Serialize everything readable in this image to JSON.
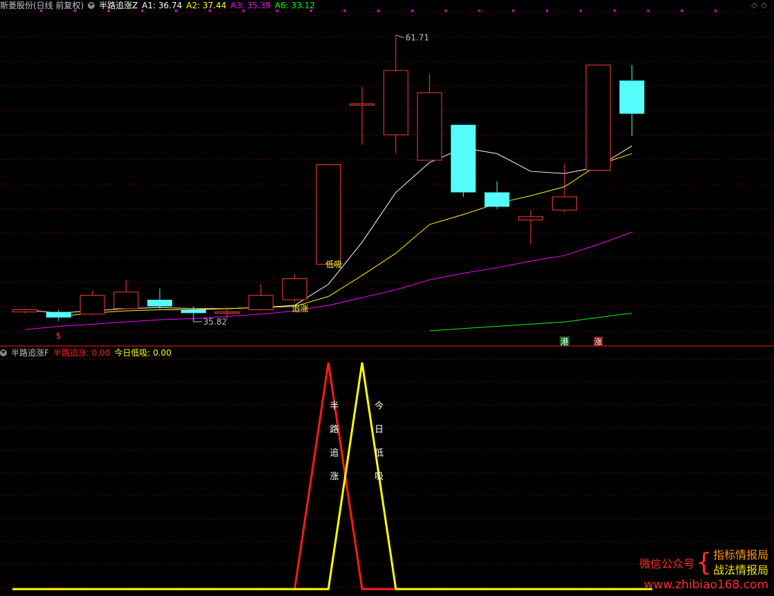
{
  "header_top": {
    "stock": "斯菱股份(日线 前复权)",
    "indicator": "半路追涨Z",
    "a1": "A1: 36.74",
    "a2": "A2: 37.44",
    "a3": "A3: 35.39",
    "a6": "A6: 33.12",
    "colors": {
      "stock": "#c0c0c0",
      "indicator": "#ffffff",
      "a1": "#ffffff",
      "a2": "#ffff00",
      "a3": "#ff00ff",
      "a6": "#00ff00"
    }
  },
  "header_bottom": {
    "indicator": "半路追涨F",
    "v1": "半路追涨: 0.00",
    "v2": "今日低吸: 0.00",
    "colors": {
      "indicator": "#c0c0c0",
      "v1": "#ff2020",
      "v2": "#ffff00"
    }
  },
  "watermark": {
    "wx": "微信公众号",
    "l1": "指标情报局",
    "l2": "战法情报局",
    "url": "www.zhibiao168.com"
  },
  "chart_data": [
    {
      "type": "candlestick",
      "price_range": [
        34.0,
        63.0
      ],
      "candles": [
        {
          "o": 36.7,
          "c": 36.9,
          "h": 37.0,
          "l": 36.6
        },
        {
          "o": 36.7,
          "c": 36.2,
          "h": 36.9,
          "l": 35.9
        },
        {
          "o": 36.5,
          "c": 38.2,
          "h": 38.6,
          "l": 36.4
        },
        {
          "o": 37.0,
          "c": 38.5,
          "h": 39.6,
          "l": 36.9
        },
        {
          "o": 37.8,
          "c": 37.2,
          "h": 38.8,
          "l": 37.0
        },
        {
          "o": 36.9,
          "c": 36.6,
          "h": 37.2,
          "l": 35.82
        },
        {
          "o": 36.7,
          "c": 36.7,
          "h": 37.1,
          "l": 36.0
        },
        {
          "o": 36.9,
          "c": 38.2,
          "h": 39.2,
          "l": 36.8
        },
        {
          "o": 37.8,
          "c": 39.7,
          "h": 40.1,
          "l": 37.6
        },
        {
          "o": 41.0,
          "c": 50.0,
          "h": 50.0,
          "l": 41.0
        },
        {
          "o": 55.5,
          "c": 55.5,
          "h": 57.0,
          "l": 51.8
        },
        {
          "o": 52.7,
          "c": 58.5,
          "h": 61.71,
          "l": 51.0
        },
        {
          "o": 50.4,
          "c": 56.5,
          "h": 58.2,
          "l": 50.4
        },
        {
          "o": 53.6,
          "c": 47.5,
          "h": 53.6,
          "l": 47.1
        },
        {
          "o": 47.5,
          "c": 46.2,
          "h": 48.5,
          "l": 46.0
        },
        {
          "o": 45.0,
          "c": 45.3,
          "h": 45.9,
          "l": 42.8
        },
        {
          "o": 45.9,
          "c": 47.1,
          "h": 50.1,
          "l": 45.7
        },
        {
          "o": 49.5,
          "c": 59.0,
          "h": 59.0,
          "l": 49.5
        },
        {
          "o": 57.6,
          "c": 54.6,
          "h": 59.0,
          "l": 52.6
        }
      ],
      "up_color": "#ff3c3c",
      "down_color": "#54fcfc",
      "lines": [
        {
          "name": "A1",
          "color": "#ffffff",
          "values": [
            36.9,
            36.6,
            36.8,
            37.0,
            37.1,
            37.0,
            37.0,
            37.1,
            37.3,
            39.2,
            43.0,
            47.5,
            50.2,
            51.5,
            51.0,
            49.4,
            49.2,
            49.8,
            51.7
          ]
        },
        {
          "name": "A2",
          "color": "#ffff00",
          "values": [
            null,
            36.3,
            36.6,
            36.8,
            36.9,
            36.9,
            37.0,
            37.1,
            37.2,
            38.1,
            40.0,
            42.0,
            44.6,
            45.5,
            46.5,
            47.2,
            48.0,
            50.0,
            51.0
          ]
        },
        {
          "name": "A3",
          "color": "#ff00ff",
          "values": [
            35.1,
            35.4,
            35.6,
            35.8,
            36.0,
            36.1,
            36.3,
            36.5,
            36.8,
            37.3,
            38.0,
            38.7,
            39.6,
            40.2,
            40.7,
            41.3,
            41.8,
            42.8,
            43.9
          ]
        },
        {
          "name": "A6",
          "color": "#00ff00",
          "values": [
            null,
            null,
            null,
            null,
            null,
            null,
            null,
            null,
            null,
            null,
            null,
            null,
            35.0,
            35.2,
            35.4,
            35.6,
            35.8,
            36.2,
            36.6
          ]
        }
      ],
      "annotations": [
        {
          "text": "61.71",
          "candle": 11,
          "price": 61.71,
          "color": "#c0c0c0"
        },
        {
          "text": "35.82",
          "candle": 5,
          "price": 35.82,
          "color": "#c0c0c0"
        },
        {
          "text": "低吸",
          "candle": 9,
          "price": 41.0,
          "color": "#ffff00"
        },
        {
          "text": "追涨",
          "candle": 8,
          "price": 37.0,
          "color": "#ffff00"
        },
        {
          "text": "$",
          "candle": 1,
          "price": 34.3,
          "color": "#ff3030"
        }
      ],
      "badges": [
        {
          "text": "港",
          "candle": 16,
          "bg": "#0b5c1e",
          "color": "#ffffff"
        },
        {
          "text": "涨",
          "candle": 17,
          "bg": "#6b1010",
          "color": "#ffffff"
        }
      ]
    },
    {
      "type": "line",
      "y_range": [
        0,
        1
      ],
      "series": [
        {
          "name": "半路追涨",
          "color": "#ff1a1a",
          "values": [
            0,
            0,
            0,
            0,
            0,
            0,
            0,
            0,
            0,
            1,
            0,
            0,
            0,
            0,
            0,
            0,
            0,
            0,
            0
          ]
        },
        {
          "name": "今日低吸",
          "color": "#ffff00",
          "values": [
            0,
            0,
            0,
            0,
            0,
            0,
            0,
            0,
            0,
            0,
            1,
            0,
            0,
            0,
            0,
            0,
            0,
            0,
            0
          ]
        }
      ],
      "vertical_labels": [
        {
          "text": "半路追涨",
          "candle": 9
        },
        {
          "text": "今日低吸",
          "candle": 10
        }
      ]
    }
  ]
}
